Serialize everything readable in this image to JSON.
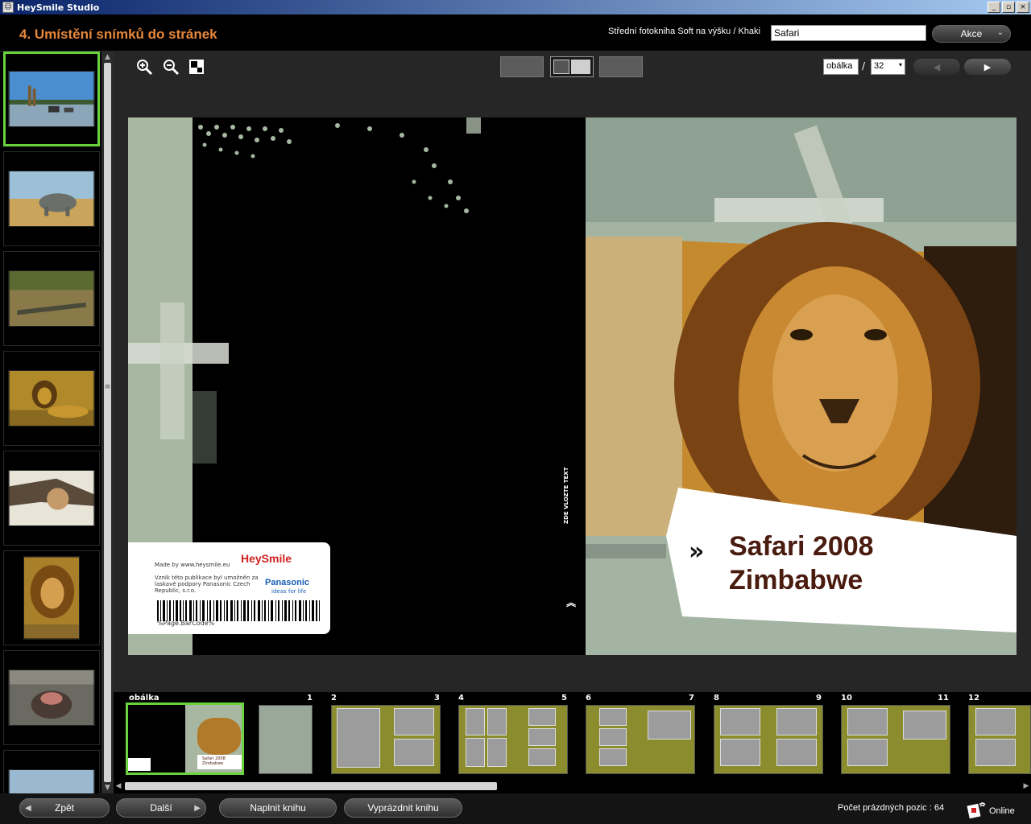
{
  "window": {
    "title": "HeySmile Studio",
    "minimize": "_",
    "maximize": "▫",
    "close": "×"
  },
  "header": {
    "step_title": "4. Umístění snímků do stránek",
    "book_info": "Střední fotokniha Soft na výšku / Khaki",
    "name_value": "Safari",
    "actions_label": "Akce"
  },
  "toolbar": {
    "zoom_in": "zoom-in",
    "zoom_out": "zoom-out",
    "page_selector": "obálka",
    "page_total": "32",
    "slash": "/"
  },
  "cover": {
    "made_by": "Made by www.heysmile.eu",
    "credits": "Vznik této publikace byl umožněn za laskavé podpory Panasonic Czech Republic, s.r.o.",
    "brand": "HeySmile",
    "sponsor": "Panasonic",
    "sponsor_tagline": "ideas for life",
    "barcode_text": "%Page.BarCode%",
    "vertical_text": "ZDE VLOZTE TEXT",
    "title_line1": "Safari 2008",
    "title_line2": "Zimbabwe"
  },
  "filmstrip": {
    "cover_label": "obálka",
    "spread_cover_title": "Safari 2008 Zimbabwe",
    "page_labels": [
      "1",
      "2",
      "3",
      "4",
      "5",
      "6",
      "7",
      "8",
      "9",
      "10",
      "11",
      "12"
    ]
  },
  "footer": {
    "back": "Zpět",
    "next": "Další",
    "fill_book": "Naplnit knihu",
    "empty_book": "Vyprázdnit knihu",
    "empty_positions_label": "Počet prázdných pozic :",
    "empty_positions_value": "64",
    "status": "Online"
  },
  "thumbnails": [
    "giraffes-waterhole",
    "rhino",
    "crocodile",
    "lion-lying",
    "lioness-tree",
    "lion-portrait",
    "hippo",
    "plains"
  ]
}
